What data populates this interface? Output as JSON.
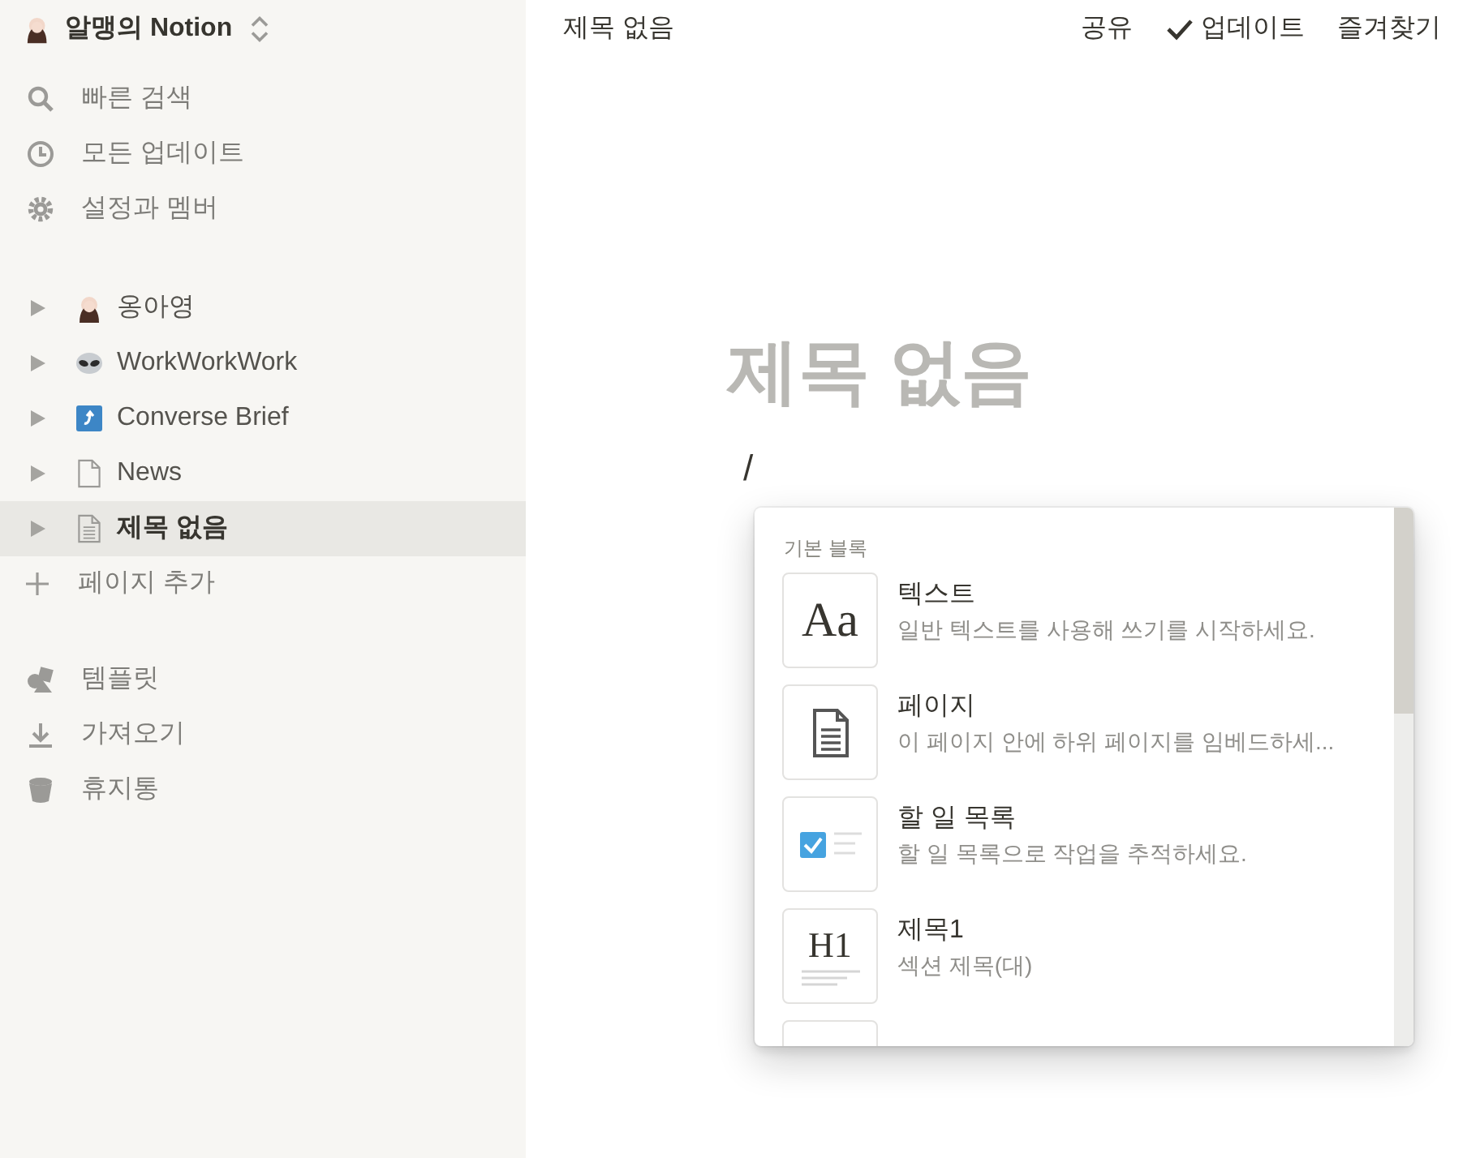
{
  "workspace": {
    "name": "알맹의 Notion"
  },
  "sidebar": {
    "actions": [
      {
        "label": "빠른 검색",
        "kind": "search"
      },
      {
        "label": "모든 업데이트",
        "kind": "updates"
      },
      {
        "label": "설정과 멤버",
        "kind": "settings"
      }
    ],
    "pages": [
      {
        "label": "옹아영",
        "kind": "avatar",
        "selected": false
      },
      {
        "label": "WorkWorkWork",
        "kind": "alien",
        "selected": false
      },
      {
        "label": "Converse Brief",
        "kind": "app",
        "selected": false
      },
      {
        "label": "News",
        "kind": "blank",
        "selected": false
      },
      {
        "label": "제목 없음",
        "kind": "text",
        "selected": true
      }
    ],
    "add_page": "페이지 추가",
    "tools": [
      {
        "label": "템플릿",
        "kind": "templates"
      },
      {
        "label": "가져오기",
        "kind": "import"
      },
      {
        "label": "휴지통",
        "kind": "trash"
      }
    ]
  },
  "topbar": {
    "breadcrumb": "제목 없음",
    "actions": [
      {
        "label": "공유",
        "kind": "plain"
      },
      {
        "label": "업데이트",
        "kind": "check"
      },
      {
        "label": "즐겨찾기",
        "kind": "plain"
      }
    ]
  },
  "page": {
    "title_placeholder": "제목 없음",
    "typed": "/"
  },
  "block_menu": {
    "section": "기본 블록",
    "items": [
      {
        "kind": "text",
        "glyph": "Aa",
        "title": "텍스트",
        "description": "일반 텍스트를 사용해 쓰기를 시작하세요."
      },
      {
        "kind": "page",
        "title": "페이지",
        "description": "이 페이지 안에 하위 페이지를 임베드하세..."
      },
      {
        "kind": "todo",
        "title": "할 일 목록",
        "description": "할 일 목록으로 작업을 추적하세요."
      },
      {
        "kind": "heading",
        "glyph": "H1",
        "title": "제목1",
        "description": "섹션 제목(대)"
      }
    ]
  }
}
